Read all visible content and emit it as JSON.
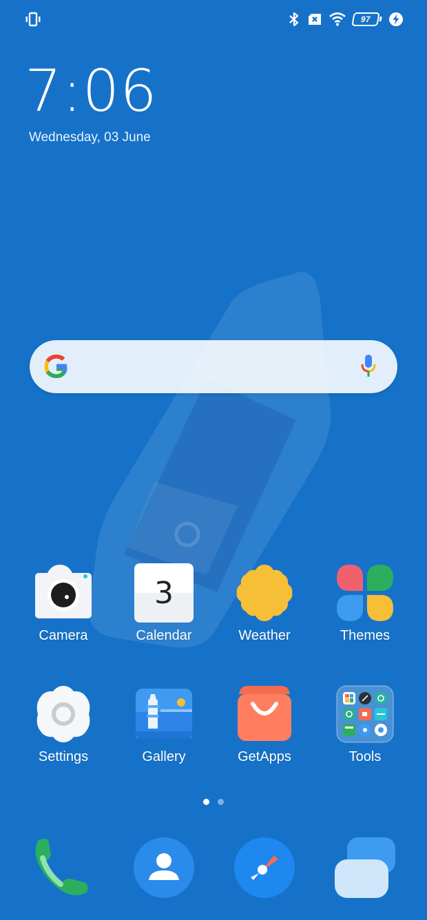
{
  "status_bar": {
    "left_icon": "vibrate-icon",
    "icons": [
      "bluetooth-icon",
      "sim-error-icon",
      "wifi-icon",
      "battery-icon",
      "charging-icon"
    ],
    "battery_level": "97"
  },
  "clock": {
    "time": "7:06",
    "date": "Wednesday, 03 June"
  },
  "search": {
    "left_icon": "google-icon",
    "right_icon": "microphone-icon"
  },
  "apps": [
    {
      "label": "Camera",
      "icon": "camera-icon"
    },
    {
      "label": "Calendar",
      "icon": "calendar-icon",
      "badge_text": "3"
    },
    {
      "label": "Weather",
      "icon": "weather-icon"
    },
    {
      "label": "Themes",
      "icon": "themes-icon"
    },
    {
      "label": "Settings",
      "icon": "settings-icon"
    },
    {
      "label": "Gallery",
      "icon": "gallery-icon"
    },
    {
      "label": "GetApps",
      "icon": "getapps-icon"
    },
    {
      "label": "Tools",
      "icon": "tools-folder-icon"
    }
  ],
  "page_indicator": {
    "pages": 2,
    "current": 1
  },
  "dock": [
    {
      "icon": "phone-icon"
    },
    {
      "icon": "contacts-icon"
    },
    {
      "icon": "browser-icon"
    },
    {
      "icon": "messages-icon"
    }
  ],
  "colors": {
    "background": "#1672C9",
    "accent": "#2A8BEA"
  }
}
